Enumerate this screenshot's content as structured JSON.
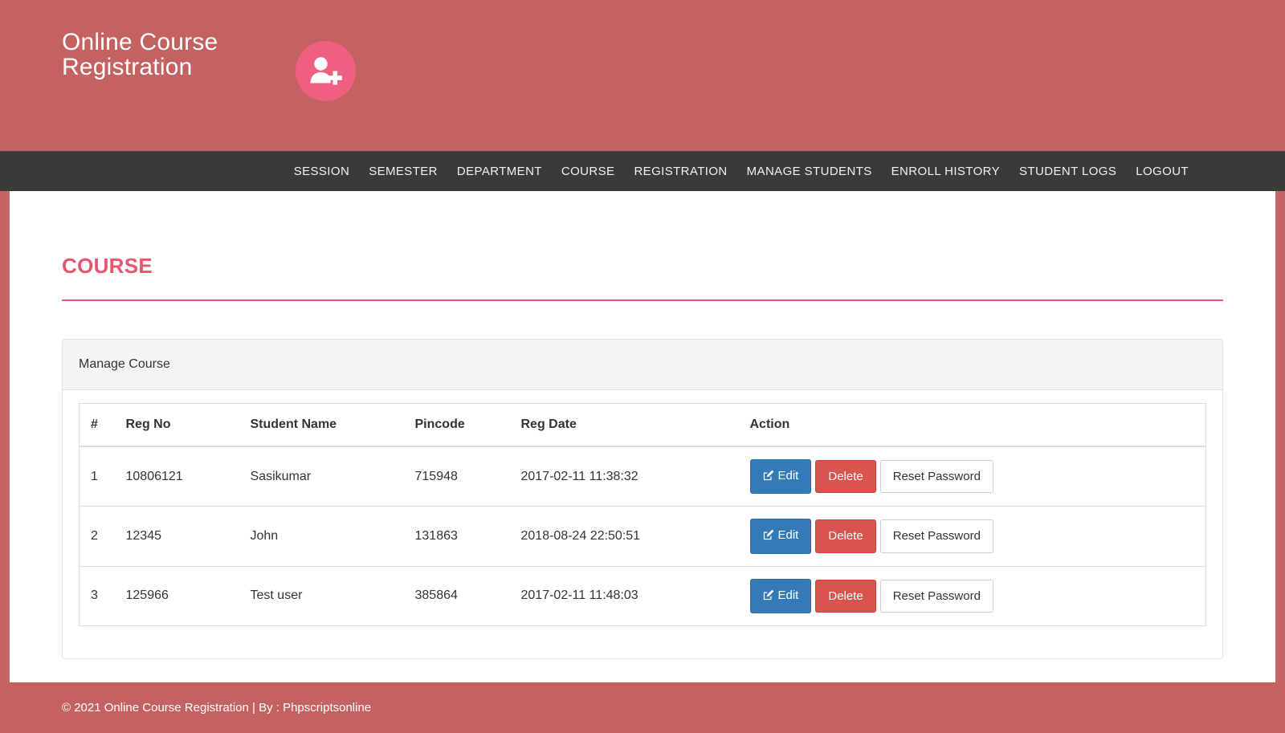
{
  "header": {
    "brand_title": "Online Course Registration",
    "logo_icon": "user-plus-icon",
    "background_color": "#c46161",
    "logo_circle_color": "#ef6080"
  },
  "navbar": {
    "background_color": "#3a3a3a",
    "items": [
      {
        "label": "SESSION",
        "name": "nav-item-session"
      },
      {
        "label": "SEMESTER",
        "name": "nav-item-semester"
      },
      {
        "label": "DEPARTMENT",
        "name": "nav-item-department"
      },
      {
        "label": "COURSE",
        "name": "nav-item-course"
      },
      {
        "label": "REGISTRATION",
        "name": "nav-item-registration"
      },
      {
        "label": "MANAGE STUDENTS",
        "name": "nav-item-manage-students"
      },
      {
        "label": "ENROLL HISTORY",
        "name": "nav-item-enroll-history"
      },
      {
        "label": "STUDENT LOGS",
        "name": "nav-item-student-logs"
      },
      {
        "label": "LOGOUT",
        "name": "nav-item-logout"
      }
    ]
  },
  "main": {
    "page_title": "COURSE",
    "page_title_color": "#e6566e",
    "panel_heading": "Manage Course",
    "table": {
      "columns": [
        "#",
        "Reg No",
        "Student Name",
        "Pincode",
        "Reg Date",
        "Action"
      ],
      "rows": [
        {
          "num": "1",
          "reg_no": "10806121",
          "student_name": "Sasikumar",
          "pincode": "715948",
          "reg_date": "2017-02-11 11:38:32"
        },
        {
          "num": "2",
          "reg_no": "12345",
          "student_name": "John",
          "pincode": "131863",
          "reg_date": "2018-08-24 22:50:51"
        },
        {
          "num": "3",
          "reg_no": "125966",
          "student_name": "Test user",
          "pincode": "385864",
          "reg_date": "2017-02-11 11:48:03"
        }
      ],
      "action_buttons": {
        "edit_label": "Edit",
        "edit_icon": "pen-to-square-icon",
        "edit_color": "#337ab7",
        "delete_label": "Delete",
        "delete_color": "#d9534f",
        "reset_label": "Reset Password"
      }
    }
  },
  "footer": {
    "text": "© 2021 Online Course Registration | By : Phpscriptsonline",
    "background_color": "#c46161"
  }
}
